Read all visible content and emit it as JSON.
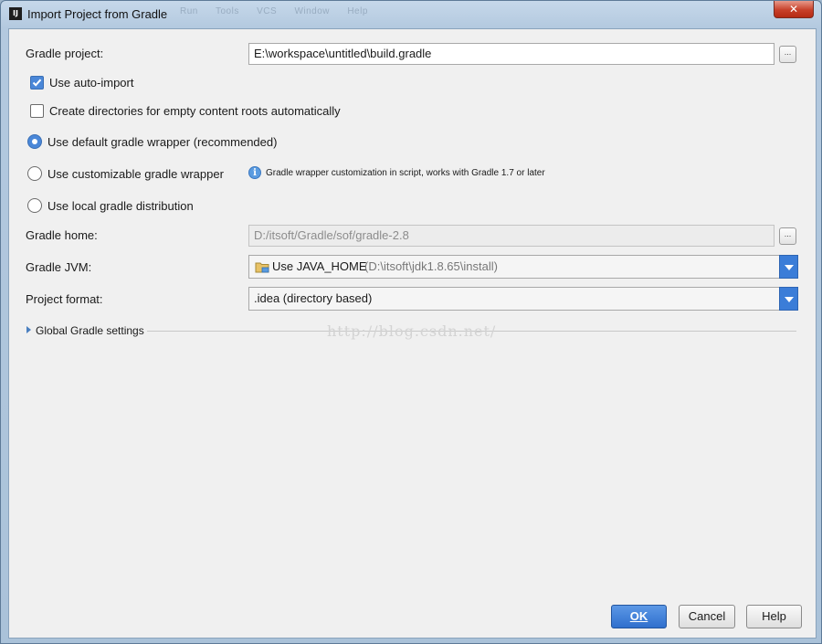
{
  "window": {
    "title": "Import Project from Gradle",
    "app_icon_text": "IJ",
    "close_symbol": "✕",
    "background_menu": [
      "Run",
      "Tools",
      "VCS",
      "Window",
      "Help"
    ]
  },
  "form": {
    "gradle_project_label": "Gradle project:",
    "gradle_project_value": "E:\\workspace\\untitled\\build.gradle",
    "browse_label": "...",
    "use_auto_import_label": "Use auto-import",
    "use_auto_import_checked": true,
    "create_dirs_label": "Create directories for empty content roots automatically",
    "create_dirs_checked": false,
    "radio_options": [
      {
        "label": "Use default gradle wrapper (recommended)",
        "selected": true
      },
      {
        "label": "Use customizable gradle wrapper",
        "selected": false
      },
      {
        "label": "Use local gradle distribution",
        "selected": false
      }
    ],
    "wrapper_hint": "Gradle wrapper customization in script, works with Gradle 1.7 or later",
    "gradle_home_label": "Gradle home:",
    "gradle_home_value": "D:/itsoft/Gradle/sof/gradle-2.8",
    "gradle_jvm_label": "Gradle JVM:",
    "gradle_jvm_value": "Use JAVA_HOME",
    "gradle_jvm_path": "(D:\\itsoft\\jdk1.8.65\\install)",
    "project_format_label": "Project format:",
    "project_format_value": ".idea (directory based)",
    "global_settings_label": "Global Gradle settings"
  },
  "watermark": "http://blog.csdn.net/",
  "buttons": {
    "ok": "OK",
    "cancel": "Cancel",
    "help": "Help"
  },
  "colors": {
    "accent": "#3b7dd8",
    "close": "#c7402a"
  },
  "icons": {
    "info": "info-icon",
    "folder": "folder-icon",
    "expand": "triangle-right-icon"
  }
}
